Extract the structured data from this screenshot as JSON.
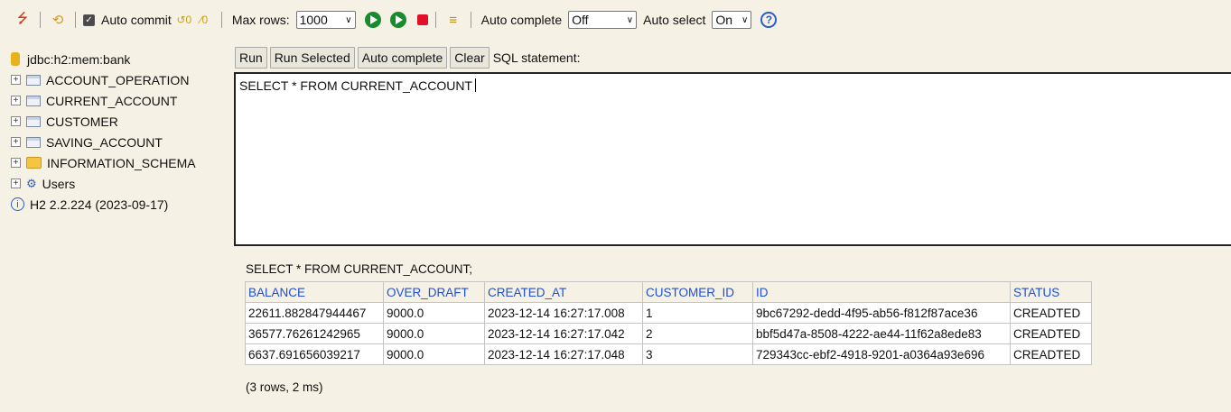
{
  "colors": {
    "background": "#f5f1e4",
    "link": "#1f4fd6",
    "run": "#1a8a2e",
    "stop": "#e0102a"
  },
  "toolbar": {
    "auto_commit_label": "Auto commit",
    "auto_commit_checked": true,
    "max_rows_label": "Max rows:",
    "max_rows_value": "1000",
    "auto_complete_label": "Auto complete",
    "auto_complete_value": "Off",
    "auto_select_label": "Auto select",
    "auto_select_value": "On",
    "help_glyph": "?"
  },
  "tree": {
    "connection": "jdbc:h2:mem:bank",
    "tables": [
      "ACCOUNT_OPERATION",
      "CURRENT_ACCOUNT",
      "CUSTOMER",
      "SAVING_ACCOUNT"
    ],
    "schema": "INFORMATION_SCHEMA",
    "users": "Users",
    "version": "H2 2.2.224 (2023-09-17)"
  },
  "buttons": {
    "run": "Run",
    "run_selected": "Run Selected",
    "auto_complete": "Auto complete",
    "clear": "Clear",
    "sql_statement_label": "SQL statement:"
  },
  "editor": {
    "text": "SELECT * FROM CURRENT_ACCOUNT"
  },
  "result": {
    "query": "SELECT * FROM CURRENT_ACCOUNT;",
    "columns": [
      "BALANCE",
      "OVER_DRAFT",
      "CREATED_AT",
      "CUSTOMER_ID",
      "ID",
      "STATUS"
    ],
    "rows": [
      [
        "22611.882847944467",
        "9000.0",
        "2023-12-14 16:27:17.008",
        "1",
        "9bc67292-dedd-4f95-ab56-f812f87ace36",
        "CREADTED"
      ],
      [
        "36577.76261242965",
        "9000.0",
        "2023-12-14 16:27:17.042",
        "2",
        "bbf5d47a-8508-4222-ae44-11f62a8ede83",
        "CREADTED"
      ],
      [
        "6637.691656039217",
        "9000.0",
        "2023-12-14 16:27:17.048",
        "3",
        "729343cc-ebf2-4918-9201-a0364a93e696",
        "CREADTED"
      ]
    ],
    "footer": "(3 rows, 2 ms)"
  }
}
